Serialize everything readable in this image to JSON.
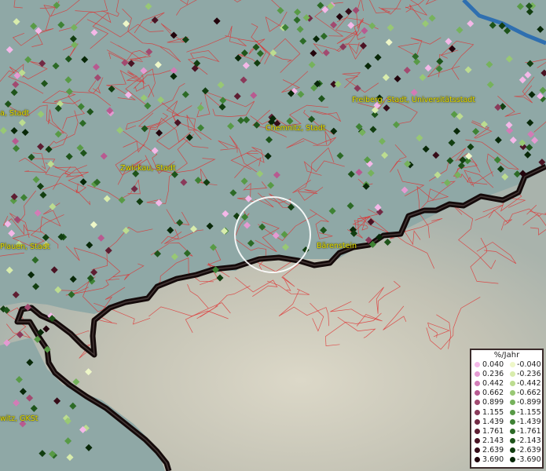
{
  "map": {
    "places": [
      {
        "id": "freiberg",
        "label": "Freiberg, Stadt, Universitätsstadt"
      },
      {
        "id": "chemnitz",
        "label": "Chemnitz, Stadt"
      },
      {
        "id": "zwickau",
        "label": "Zwickau, Stadt"
      },
      {
        "id": "baerenstein",
        "label": "Bärenstein"
      },
      {
        "id": "plauen",
        "label": "Plauen, Stadt"
      },
      {
        "id": "cropped_a",
        "label": "a, Stadt"
      },
      {
        "id": "cropped_witz",
        "label": "witz, GKSt"
      }
    ],
    "colors": {
      "terrain": "#8fa8a6",
      "district_lines": "#e03030",
      "border": "#1a1010",
      "label": "#e8e000"
    }
  },
  "legend": {
    "title": "%/Jahr",
    "positive": [
      {
        "value": "0.040",
        "color": "#f4b8e8"
      },
      {
        "value": "0.236",
        "color": "#e59ad2"
      },
      {
        "value": "0.442",
        "color": "#d27cb6"
      },
      {
        "value": "0.662",
        "color": "#b85a90"
      },
      {
        "value": "0.899",
        "color": "#a24a70"
      },
      {
        "value": "1.155",
        "color": "#8a3a5a"
      },
      {
        "value": "1.439",
        "color": "#722a44"
      },
      {
        "value": "1.761",
        "color": "#5e1e32"
      },
      {
        "value": "2.143",
        "color": "#4a1424"
      },
      {
        "value": "2.639",
        "color": "#360c18"
      },
      {
        "value": "3.690",
        "color": "#22040c"
      }
    ],
    "negative": [
      {
        "value": "-0.040",
        "color": "#eef7c8"
      },
      {
        "value": "-0.236",
        "color": "#d8ecac"
      },
      {
        "value": "-0.442",
        "color": "#bcdc90"
      },
      {
        "value": "-0.662",
        "color": "#98c874"
      },
      {
        "value": "-0.899",
        "color": "#76b25c"
      },
      {
        "value": "-1.155",
        "color": "#589a46"
      },
      {
        "value": "-1.439",
        "color": "#3e8234"
      },
      {
        "value": "-1.761",
        "color": "#2c6a26"
      },
      {
        "value": "-2.143",
        "color": "#1e541a"
      },
      {
        "value": "-2.639",
        "color": "#123e10"
      },
      {
        "value": "-3.690",
        "color": "#082808"
      }
    ]
  }
}
